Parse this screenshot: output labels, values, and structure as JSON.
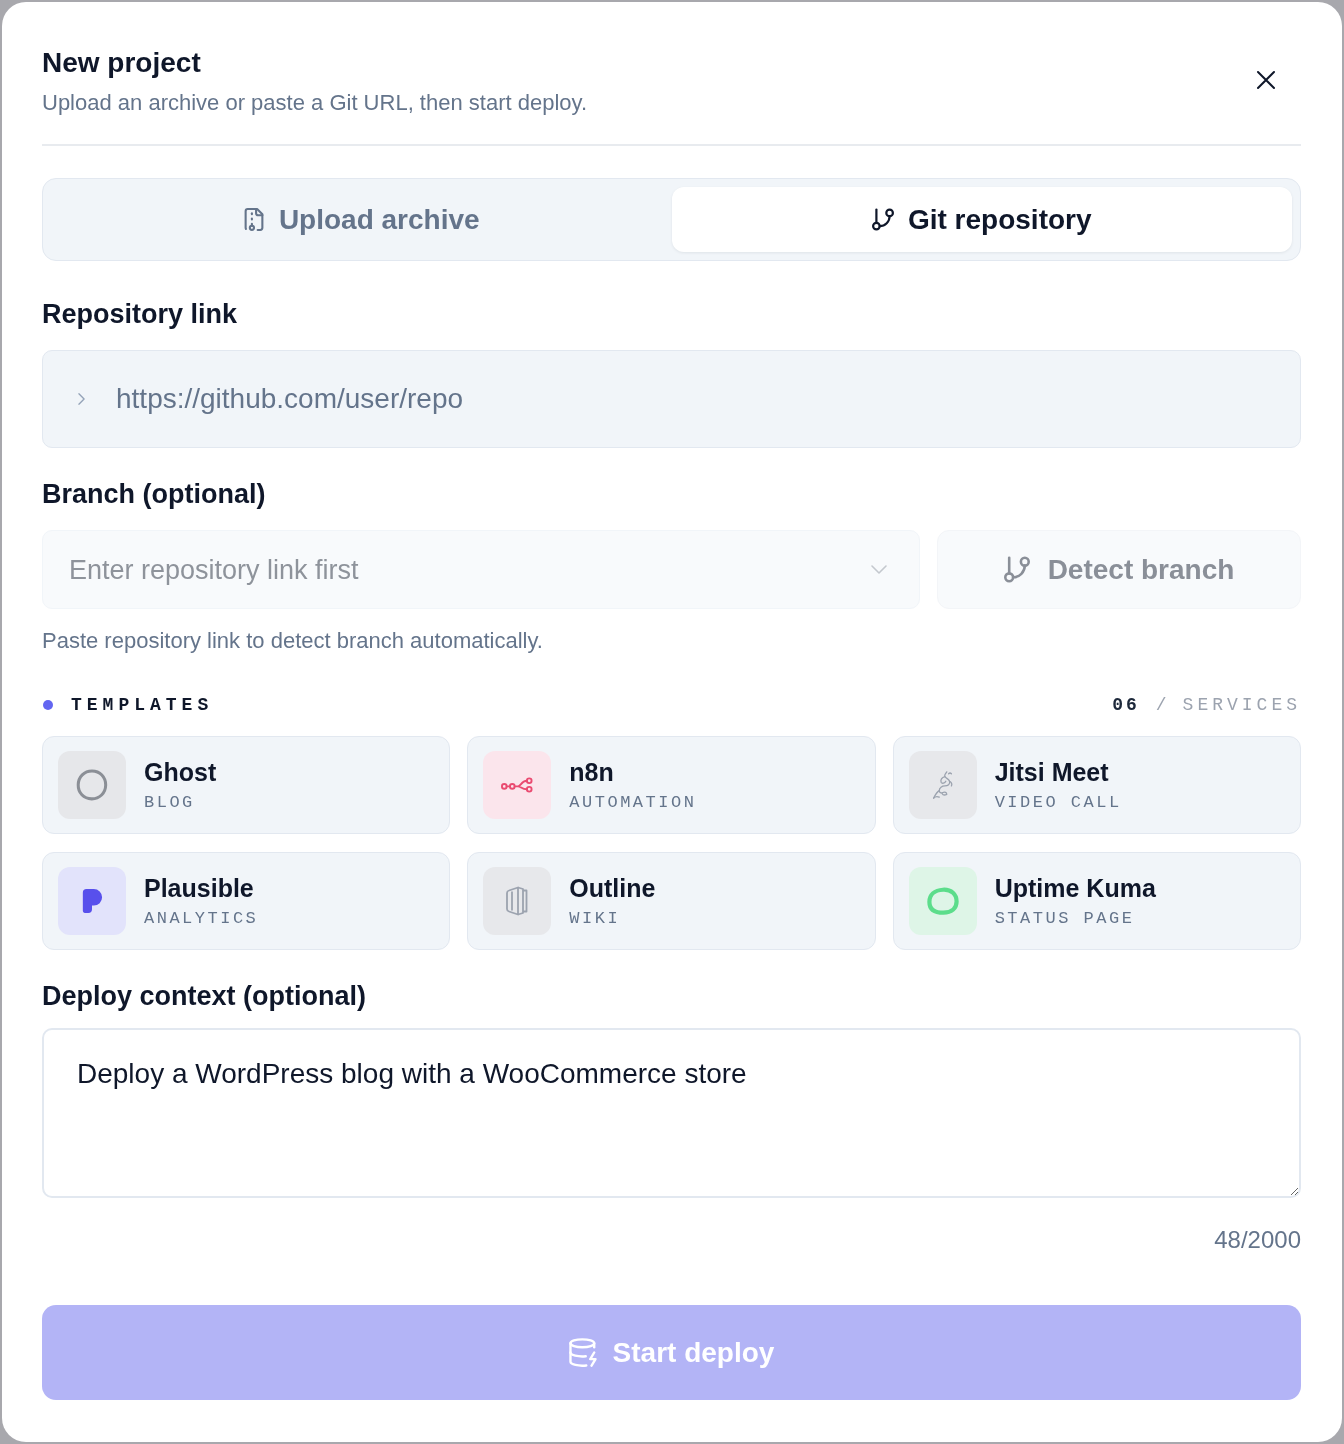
{
  "dialog": {
    "title": "New project",
    "subtitle": "Upload an archive or paste a Git URL, then start deploy."
  },
  "tabs": [
    {
      "label": "Upload archive",
      "selected": false
    },
    {
      "label": "Git repository",
      "selected": true
    }
  ],
  "repository_link": {
    "label": "Repository link",
    "placeholder": "https://github.com/user/repo"
  },
  "branch": {
    "label": "Branch (optional)",
    "select": {
      "placeholder": "Enter repository link first",
      "disabled": true
    },
    "detect_button": {
      "label": "Detect branch",
      "disabled": true
    },
    "help": "Paste repository link to detect branch automatically."
  },
  "templates": {
    "title": "TEMPLATES",
    "count": "06",
    "separator": "/",
    "unit": "SERVICES",
    "items": [
      {
        "name": "Ghost",
        "category": "BLOG"
      },
      {
        "name": "n8n",
        "category": "AUTOMATION"
      },
      {
        "name": "Jitsi Meet",
        "category": "VIDEO CALL"
      },
      {
        "name": "Plausible",
        "category": "ANALYTICS"
      },
      {
        "name": "Outline",
        "category": "WIKI"
      },
      {
        "name": "Uptime Kuma",
        "category": "STATUS PAGE"
      }
    ]
  },
  "deploy_context": {
    "label": "Deploy context (optional)",
    "value": "Deploy a WordPress blog with a WooCommerce store",
    "counter": "48/2000"
  },
  "start_button": {
    "label": "Start deploy",
    "disabled": true
  }
}
